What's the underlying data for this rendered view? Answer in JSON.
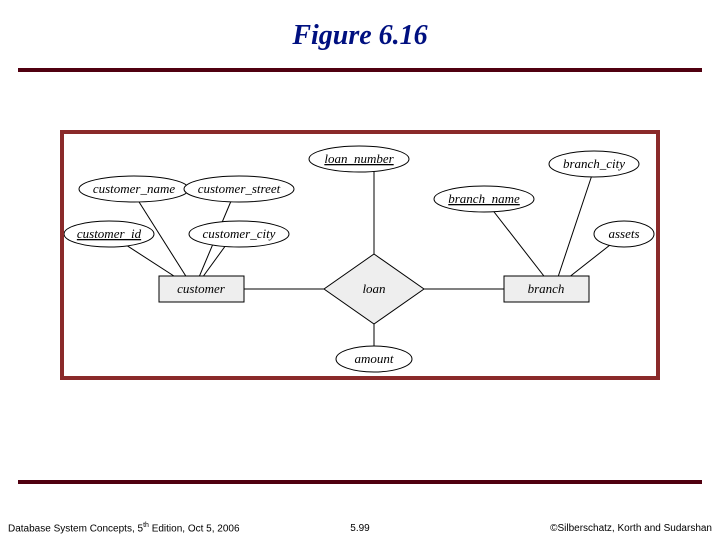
{
  "title": "Figure 6.16",
  "footer": {
    "left_a": "Database System Concepts, 5",
    "left_sup": "th",
    "left_b": " Edition, Oct 5, 2006",
    "center": "5.99",
    "right": "©Silberschatz, Korth and Sudarshan"
  },
  "diagram": {
    "entities": {
      "customer": "customer",
      "loan": "loan",
      "branch": "branch"
    },
    "attributes": {
      "customer_name": "customer_name",
      "customer_street": "customer_street",
      "customer_id": "customer_id",
      "customer_city": "customer_city",
      "loan_number": "loan_number",
      "amount": "amount",
      "branch_name": "branch_name",
      "branch_city": "branch_city",
      "assets": "assets"
    }
  }
}
